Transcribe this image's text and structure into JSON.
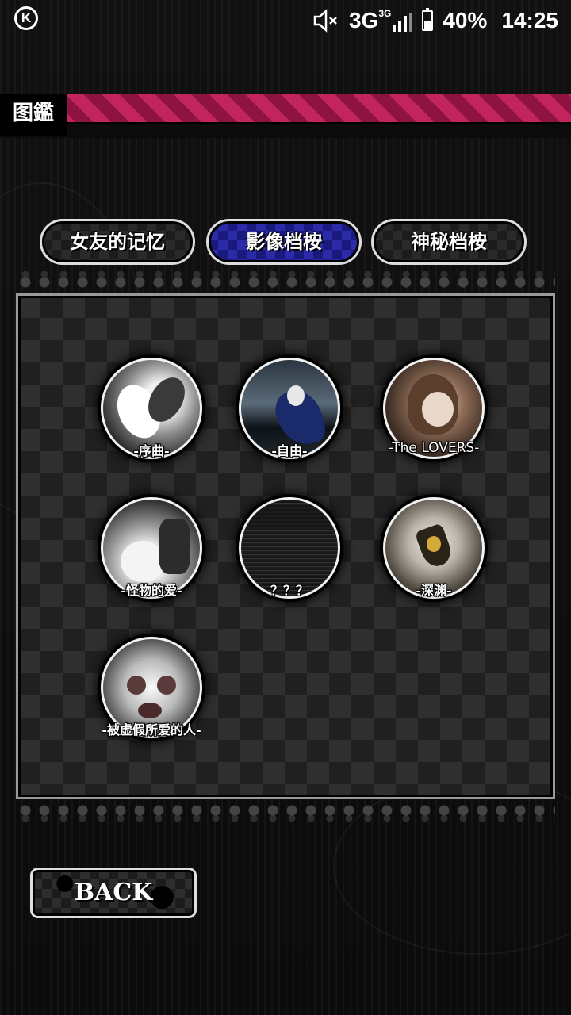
{
  "status_bar": {
    "app_icon": "k-logo-icon",
    "icons": [
      "mute-icon",
      "signal-icon",
      "battery-icon"
    ],
    "network": "3G",
    "network_small": "3G",
    "battery": "40%",
    "time": "14:25"
  },
  "header": {
    "title": "图鑑",
    "accent_color": "#c2245d"
  },
  "tabs": [
    {
      "label": "女友的记忆",
      "active": false
    },
    {
      "label": "影像档桉",
      "active": true
    },
    {
      "label": "神秘档桉",
      "active": false
    }
  ],
  "gallery": {
    "items": [
      {
        "label": "-序曲-",
        "art": "prelude"
      },
      {
        "label": "-自由-",
        "art": "freedom"
      },
      {
        "label": "-The LOVERS-",
        "art": "lovers"
      },
      {
        "label": "-怪物的爱-",
        "art": "monster"
      },
      {
        "label": "？？？",
        "art": "locked"
      },
      {
        "label": "-深渊-",
        "art": "abyss"
      },
      {
        "label": "-被虚假所爱的人-",
        "art": "beloved"
      }
    ]
  },
  "back_button": {
    "label": "BACK"
  }
}
